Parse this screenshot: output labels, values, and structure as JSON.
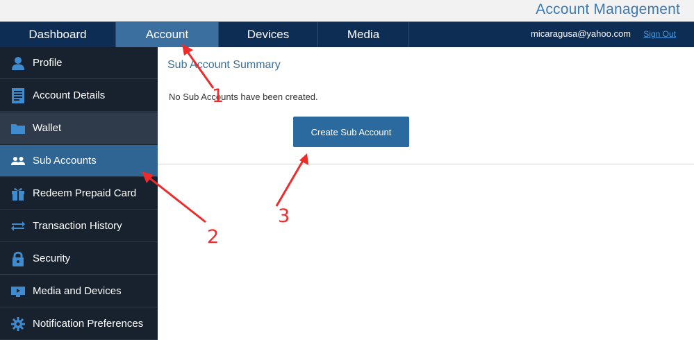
{
  "header": {
    "app_title": "Account Management"
  },
  "nav": {
    "tabs": [
      {
        "label": "Dashboard"
      },
      {
        "label": "Account",
        "active": true
      },
      {
        "label": "Devices"
      },
      {
        "label": "Media"
      }
    ],
    "user_email": "micaragusa@yahoo.com",
    "signout_label": "Sign Out"
  },
  "sidebar": {
    "items": [
      {
        "label": "Profile",
        "icon": "person-icon"
      },
      {
        "label": "Account Details",
        "icon": "document-icon"
      },
      {
        "label": "Wallet",
        "icon": "wallet-icon"
      },
      {
        "label": "Sub Accounts",
        "icon": "users-icon",
        "active": true
      },
      {
        "label": "Redeem Prepaid Card",
        "icon": "gift-icon"
      },
      {
        "label": "Transaction History",
        "icon": "transfer-arrows-icon"
      },
      {
        "label": "Security",
        "icon": "lock-icon"
      },
      {
        "label": "Media and Devices",
        "icon": "media-device-icon"
      },
      {
        "label": "Notification Preferences",
        "icon": "gear-icon"
      }
    ]
  },
  "main": {
    "title": "Sub Account Summary",
    "empty_message": "No Sub Accounts have been created.",
    "create_button": "Create Sub Account"
  },
  "annotations": {
    "labels": [
      "1",
      "2",
      "3"
    ]
  },
  "colors": {
    "navbar": "#0e2d55",
    "active_tab": "#3a6f9f",
    "sidebar": "#18222e",
    "sidebar_active": "#2e6592",
    "button": "#2b6a9e",
    "accent_text": "#3c6f98",
    "annotation": "#ee2b2b"
  }
}
